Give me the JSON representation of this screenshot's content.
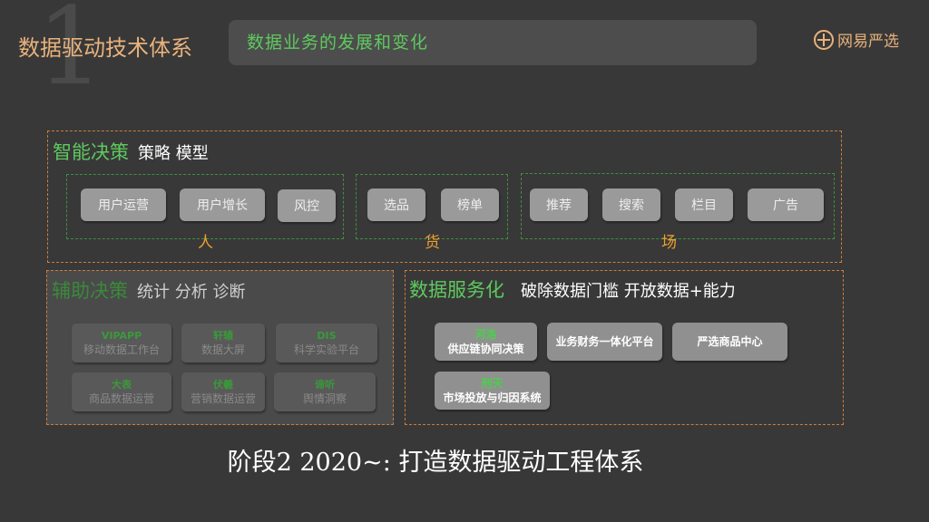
{
  "header": {
    "stage_number": "1",
    "title": "数据驱动技术体系",
    "subtitle": "数据业务的发展和变化",
    "logo_text": "网易严选"
  },
  "smart": {
    "heading": "智能决策",
    "subheading": "策略 模型",
    "groups": [
      {
        "label": "人",
        "items": [
          "用户运营",
          "用户增长",
          "风控"
        ]
      },
      {
        "label": "货",
        "items": [
          "选品",
          "榜单"
        ]
      },
      {
        "label": "场",
        "items": [
          "推荐",
          "搜索",
          "栏目",
          "广告"
        ]
      }
    ]
  },
  "aux": {
    "heading": "辅助决策",
    "subheading": "统计 分析 诊断",
    "cards": [
      {
        "name": "VIPAPP",
        "desc": "移动数据工作台"
      },
      {
        "name": "轩辕",
        "desc": "数据大屏"
      },
      {
        "name": "DIS",
        "desc": "科学实验平台"
      },
      {
        "name": "大表",
        "desc": "商品数据运营"
      },
      {
        "name": "伏羲",
        "desc": "营销数据运营"
      },
      {
        "name": "谛听",
        "desc": "舆情洞察"
      }
    ]
  },
  "service": {
    "heading": "数据服务化",
    "subheading": "破除数据门槛  开放数据+能力",
    "items": [
      {
        "name": "河洛",
        "desc": "供应链协同决策"
      },
      {
        "name": "",
        "desc": "业务财务一体化平台"
      },
      {
        "name": "",
        "desc": "严选商品中心"
      },
      {
        "name": "刑天",
        "desc": "市场投放与归因系统"
      }
    ]
  },
  "footer": "阶段2 2020~:  打造数据驱动工程体系",
  "colors": {
    "background": "#383838",
    "accent_orange": "#e8b27c",
    "accent_green": "#5ec95e",
    "group_label": "#f0a030"
  }
}
